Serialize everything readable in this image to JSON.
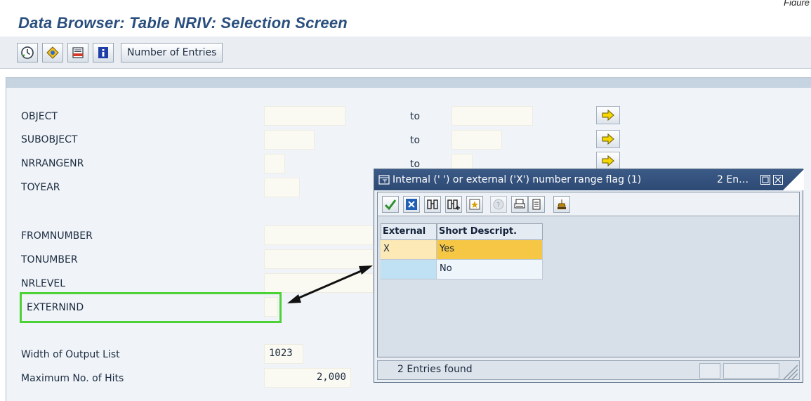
{
  "figure_label": "Figure",
  "title": "Data Browser: Table NRIV: Selection Screen",
  "toolbar": {
    "buttons": [
      {
        "icon": "execute-clock-icon"
      },
      {
        "icon": "selection-options-icon"
      },
      {
        "icon": "delete-entries-icon"
      },
      {
        "icon": "info-icon"
      }
    ],
    "number_of_entries_label": "Number of Entries"
  },
  "fields": [
    {
      "label": "OBJECT",
      "value": "",
      "has_range": true,
      "to_label": "to"
    },
    {
      "label": "SUBOBJECT",
      "value": "",
      "has_range": true,
      "to_label": "to"
    },
    {
      "label": "NRRANGENR",
      "value": "",
      "has_range": true,
      "to_label": "to"
    },
    {
      "label": "TOYEAR",
      "value": ""
    },
    {
      "label": "FROMNUMBER",
      "value": ""
    },
    {
      "label": "TONUMBER",
      "value": ""
    },
    {
      "label": "NRLEVEL",
      "value": ""
    },
    {
      "label": "EXTERNIND",
      "value": ""
    }
  ],
  "output_settings": {
    "width_label": "Width of Output List",
    "width_value": "1023",
    "max_hits_label": "Maximum No. of Hits",
    "max_hits_value": "2,000"
  },
  "popup": {
    "title": "Internal (' ') or external ('X') number range flag (1)",
    "count_short": "2 En…",
    "columns": [
      "External",
      "Short Descript."
    ],
    "rows": [
      {
        "external": "X",
        "description": "Yes",
        "selected": true
      },
      {
        "external": "",
        "description": "No",
        "selected": false
      }
    ],
    "status": "2 Entries found"
  },
  "colors": {
    "title_blue": "#2a4f7e",
    "highlight_green": "#4cd137",
    "selected_row": "#f6c745",
    "selected_key": "#fce9b5",
    "unselected_row": "#eef6fb",
    "unselected_key": "#bfe1f3"
  }
}
